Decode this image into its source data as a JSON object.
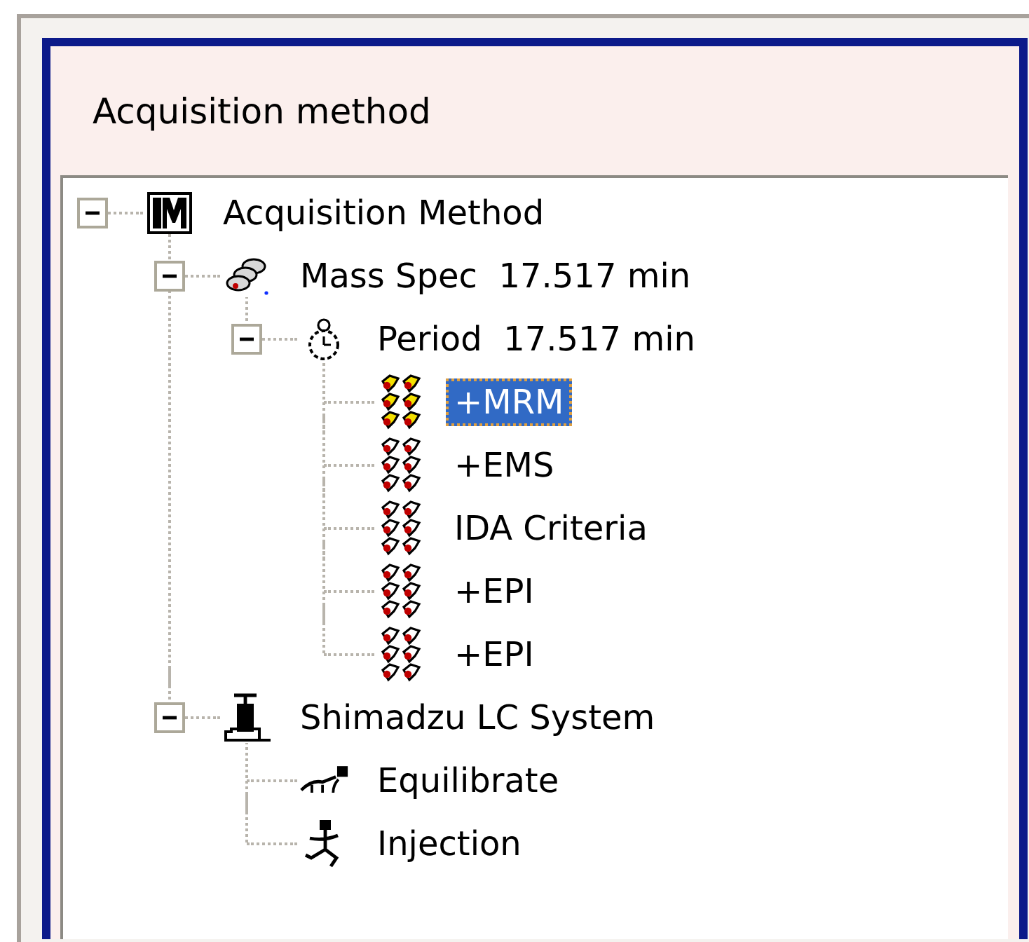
{
  "panel": {
    "title": "Acquisition method"
  },
  "tree": [
    {
      "kind": "method",
      "label": "Acquisition Method",
      "expanded": true,
      "selected": false,
      "children": [
        {
          "kind": "mass-spec",
          "label": "Mass Spec  17.517 min",
          "expanded": true,
          "selected": false,
          "children": [
            {
              "kind": "period",
              "label": "Period  17.517 min",
              "expanded": true,
              "selected": false,
              "children": [
                {
                  "kind": "experiment",
                  "label": "+MRM",
                  "selected": true
                },
                {
                  "kind": "experiment",
                  "label": "+EMS",
                  "selected": false
                },
                {
                  "kind": "experiment",
                  "label": "IDA Criteria",
                  "selected": false
                },
                {
                  "kind": "experiment",
                  "label": "+EPI",
                  "selected": false
                },
                {
                  "kind": "experiment",
                  "label": "+EPI",
                  "selected": false
                }
              ]
            }
          ]
        },
        {
          "kind": "lc-system",
          "label": "Shimadzu LC System",
          "expanded": true,
          "selected": false,
          "children": [
            {
              "kind": "equilibrate",
              "label": "Equilibrate",
              "selected": false
            },
            {
              "kind": "injection",
              "label": "Injection",
              "selected": false
            }
          ]
        }
      ]
    }
  ]
}
